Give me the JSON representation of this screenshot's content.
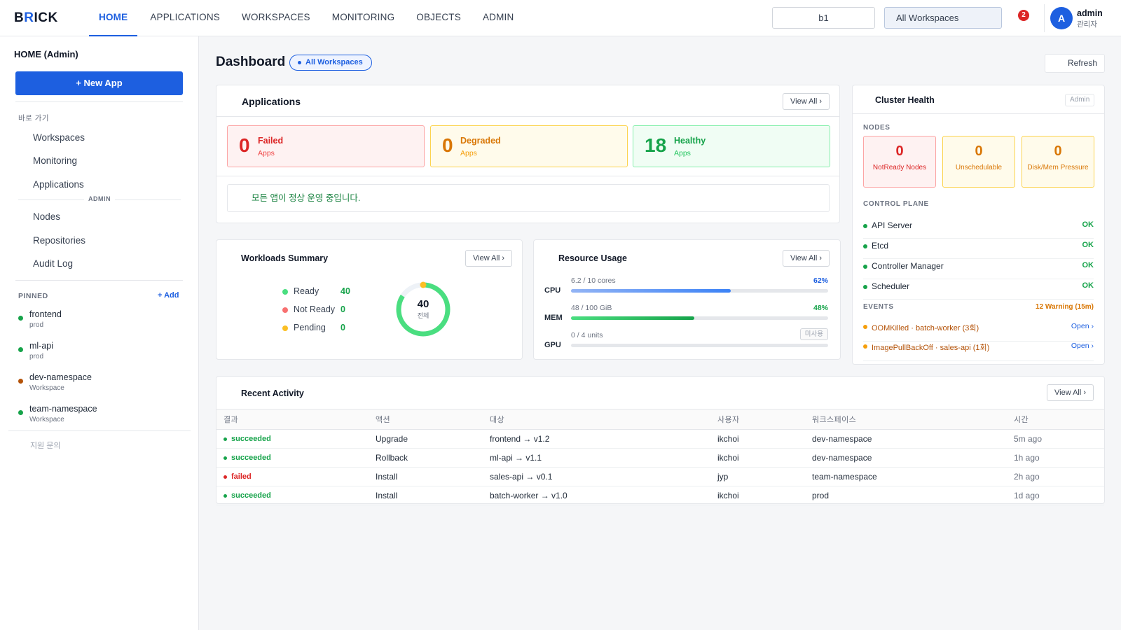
{
  "app": {
    "logo_b": "B",
    "logo_r": "R",
    "logo_rest": "ICK"
  },
  "topnav": {
    "items": [
      {
        "label": "HOME",
        "active": true
      },
      {
        "label": "APPLICATIONS"
      },
      {
        "label": "WORKSPACES"
      },
      {
        "label": "MONITORING"
      },
      {
        "label": "OBJECTS"
      },
      {
        "label": "ADMIN"
      }
    ],
    "namespace_value": "b1",
    "workspace_select": "All Workspaces",
    "notification_count": "2",
    "user": {
      "initial": "A",
      "name": "admin",
      "role": "관리자"
    }
  },
  "sidebar": {
    "title": "HOME (Admin)",
    "new_app": "+ New App",
    "shortcuts_label": "바로 가기",
    "shortcuts": [
      "Workspaces",
      "Monitoring",
      "Applications"
    ],
    "admin_label": "ADMIN",
    "admin_links": [
      "Nodes",
      "Repositories",
      "Audit Log"
    ],
    "pinned_label": "PINNED",
    "add_label": "+ Add",
    "pinned": [
      {
        "name": "frontend",
        "sub": "prod",
        "color": "#16a34a"
      },
      {
        "name": "ml-api",
        "sub": "prod",
        "color": "#16a34a"
      },
      {
        "name": "dev-namespace",
        "sub": "Workspace",
        "color": "#b45309"
      },
      {
        "name": "team-namespace",
        "sub": "Workspace",
        "color": "#16a34a"
      }
    ],
    "support": "지원 문의"
  },
  "dashboard": {
    "title": "Dashboard",
    "scope_badge": "All Workspaces",
    "refresh": "Refresh"
  },
  "applications": {
    "title": "Applications",
    "view_all": "View All ›",
    "stats": [
      {
        "value": "0",
        "label": "Failed",
        "sub": "Apps"
      },
      {
        "value": "0",
        "label": "Degraded",
        "sub": "Apps"
      },
      {
        "value": "18",
        "label": "Healthy",
        "sub": "Apps"
      }
    ],
    "message": "모든 앱이 정상 운영 중입니다."
  },
  "workloads": {
    "title": "Workloads Summary",
    "view_all": "View All ›",
    "legend": [
      {
        "name": "Ready",
        "value": "40",
        "color": "#4ade80"
      },
      {
        "name": "Not Ready",
        "value": "0",
        "color": "#f87171"
      },
      {
        "name": "Pending",
        "value": "0",
        "color": "#fbbf24"
      }
    ],
    "total": "40",
    "total_label": "전체"
  },
  "resources": {
    "title": "Resource Usage",
    "view_all": "View All ›",
    "rows": [
      {
        "key": "CPU",
        "value": "6.2 / 10 cores",
        "percent": "62%",
        "fraction": 0.62,
        "color": "#3b82f6"
      },
      {
        "key": "MEM",
        "value": "48 / 100 GiB",
        "percent": "48%",
        "fraction": 0.48,
        "color": "#22c55e"
      },
      {
        "key": "GPU",
        "value": "0 / 4 units",
        "status": "미사용",
        "fraction": 0
      }
    ]
  },
  "cluster": {
    "title": "Cluster Health",
    "admin_tag": "Admin",
    "nodes_label": "NODES",
    "nodes": [
      {
        "value": "0",
        "label": "NotReady Nodes"
      },
      {
        "value": "0",
        "label": "Unschedulable"
      },
      {
        "value": "0",
        "label": "Disk/Mem Pressure"
      }
    ],
    "control_plane_label": "CONTROL PLANE",
    "control_plane": [
      {
        "name": "API Server",
        "status": "OK"
      },
      {
        "name": "Etcd",
        "status": "OK"
      },
      {
        "name": "Controller Manager",
        "status": "OK"
      },
      {
        "name": "Scheduler",
        "status": "OK"
      }
    ],
    "events_label": "EVENTS",
    "events_summary": "12 Warning (15m)",
    "events": [
      {
        "text": "OOMKilled · batch-worker (3회)",
        "action": "Open ›"
      },
      {
        "text": "ImagePullBackOff · sales-api (1회)",
        "action": "Open ›"
      }
    ]
  },
  "activity": {
    "title": "Recent Activity",
    "view_all": "View All ›",
    "columns": [
      "결과",
      "액션",
      "대상",
      "사용자",
      "워크스페이스",
      "시간"
    ],
    "rows": [
      {
        "result": "succeeded",
        "action": "Upgrade",
        "target": "frontend → v1.2",
        "user": "ikchoi",
        "workspace": "dev-namespace",
        "time": "5m ago"
      },
      {
        "result": "succeeded",
        "action": "Rollback",
        "target": "ml-api → v1.1",
        "user": "ikchoi",
        "workspace": "dev-namespace",
        "time": "1h ago"
      },
      {
        "result": "failed",
        "action": "Install",
        "target": "sales-api → v0.1",
        "user": "jyp",
        "workspace": "team-namespace",
        "time": "2h ago"
      },
      {
        "result": "succeeded",
        "action": "Install",
        "target": "batch-worker → v1.0",
        "user": "ikchoi",
        "workspace": "prod",
        "time": "1d ago"
      }
    ]
  },
  "colors": {
    "accent": "#1d5fe0",
    "success": "#16a34a",
    "danger": "#dc2626",
    "warning": "#d97706"
  }
}
